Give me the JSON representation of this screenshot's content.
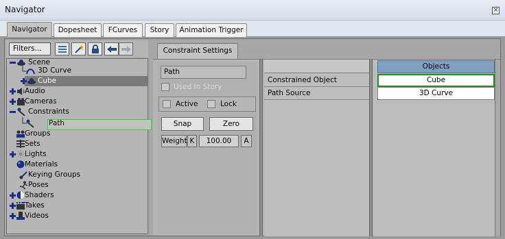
{
  "window": {
    "title": "Navigator",
    "close_glyph": "×"
  },
  "tabs": [
    {
      "label": "Navigator",
      "active": true
    },
    {
      "label": "Dopesheet",
      "active": false
    },
    {
      "label": "FCurves",
      "active": false
    },
    {
      "label": "Story",
      "active": false
    },
    {
      "label": "Animation Trigger",
      "active": false
    }
  ],
  "toolbar": {
    "filters_label": "Filters...",
    "icons": [
      "list-view-icon",
      "wand-icon",
      "lock-icon",
      "back-arrow-icon",
      "forward-arrow-icon"
    ]
  },
  "tree": [
    {
      "label": "Scene",
      "icon": "scene-icon",
      "expander": "minus"
    },
    {
      "label": "3D Curve",
      "icon": "curve-icon",
      "expander": "none"
    },
    {
      "label": "Cube",
      "icon": "model-icon",
      "expander": "plus",
      "selected": true
    },
    {
      "label": "Audio",
      "icon": "audio-icon",
      "expander": "plus"
    },
    {
      "label": "Cameras",
      "icon": "camera-icon",
      "expander": "plus"
    },
    {
      "label": "Constraints",
      "icon": "constraint-icon",
      "expander": "minus"
    },
    {
      "label": "Path",
      "icon": "path-constraint-icon",
      "expander": "none",
      "focused": true
    },
    {
      "label": "Groups",
      "icon": "groups-icon",
      "expander": "none"
    },
    {
      "label": "Sets",
      "icon": "sets-icon",
      "expander": "none"
    },
    {
      "label": "Lights",
      "icon": "light-icon",
      "expander": "plus"
    },
    {
      "label": "Materials",
      "icon": "material-icon",
      "expander": "none"
    },
    {
      "label": "Keying Groups",
      "icon": "keying-icon",
      "expander": "none"
    },
    {
      "label": "Poses",
      "icon": "pose-icon",
      "expander": "none"
    },
    {
      "label": "Shaders",
      "icon": "shader-icon",
      "expander": "plus"
    },
    {
      "label": "Takes",
      "icon": "takes-icon",
      "expander": "plus"
    },
    {
      "label": "Videos",
      "icon": "video-icon",
      "expander": "plus"
    }
  ],
  "constraint": {
    "tab_label": "Constraint Settings",
    "name": "Path",
    "used_in_story_label": "Used In Story",
    "active_label": "Active",
    "lock_label": "Lock",
    "snap_label": "Snap",
    "zero_label": "Zero",
    "weight_label": "Weight",
    "weight_k": "K",
    "weight_value": "100.00",
    "weight_a": "A"
  },
  "reference_grid": {
    "header": "",
    "rows": [
      "Constrained Object",
      "Path Source"
    ]
  },
  "objects_grid": {
    "header": "Objects",
    "rows": [
      "Cube",
      "3D Curve"
    ]
  },
  "colors": {
    "selection_green": "#1e8e1e",
    "header_blue": "#7f9fc4",
    "tree_expander_blue": "#1b2f8a"
  }
}
